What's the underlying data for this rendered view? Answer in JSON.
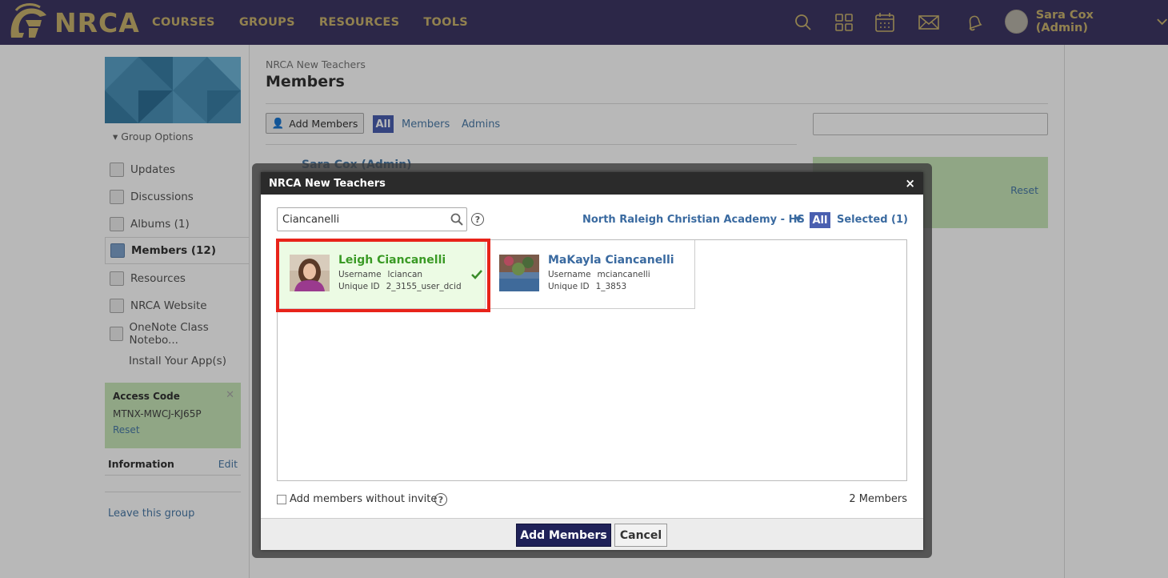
{
  "nav": {
    "brand": "NRCA",
    "links": [
      "COURSES",
      "GROUPS",
      "RESOURCES",
      "TOOLS"
    ],
    "icons": [
      "search-icon",
      "grid-icon",
      "calendar-icon",
      "mail-icon",
      "bell-icon"
    ],
    "user": "Sara Cox (Admin)"
  },
  "sidebar": {
    "group_options": "Group Options",
    "items": [
      {
        "label": "Updates",
        "icon": "updates-icon"
      },
      {
        "label": "Discussions",
        "icon": "discussions-icon"
      },
      {
        "label": "Albums (1)",
        "icon": "albums-icon"
      },
      {
        "label": "Members (12)",
        "icon": "members-icon"
      },
      {
        "label": "Resources",
        "icon": "resources-icon"
      },
      {
        "label": "NRCA Website",
        "icon": "website-icon"
      },
      {
        "label": "OneNote Class Notebo...",
        "icon": "onenote-icon"
      },
      {
        "label": "Install Your App(s)",
        "icon": ""
      }
    ],
    "access_code": {
      "title": "Access Code",
      "code": "MTNX-MWCJ-KJ65P",
      "reset": "Reset"
    },
    "information": {
      "title": "Information",
      "edit": "Edit"
    },
    "leave": "Leave this group"
  },
  "main": {
    "breadcrumb": "NRCA New Teachers",
    "title": "Members",
    "add_members_button": "Add Members",
    "filters": {
      "all": "All",
      "members": "Members",
      "admins": "Admins"
    },
    "first_member": "Sara Cox (Admin)",
    "right_panel_reset": "Reset"
  },
  "modal": {
    "title": "NRCA New Teachers",
    "close": "×",
    "search_value": "Ciancanelli",
    "help": "?",
    "school": "North Raleigh Christian Academy - HS",
    "tab_all": "All",
    "tab_selected": "Selected (1)",
    "results": [
      {
        "name": "Leigh Ciancanelli",
        "username_label": "Username",
        "username": "lciancan",
        "uid_label": "Unique ID",
        "uid": "2_3155_user_dcid",
        "selected": true
      },
      {
        "name": "MaKayla Ciancanelli",
        "username_label": "Username",
        "username": "mciancanelli",
        "uid_label": "Unique ID",
        "uid": "1_3853",
        "selected": false
      }
    ],
    "add_without_invite": "Add members without invite",
    "count": "2 Members",
    "add_button": "Add Members",
    "cancel_button": "Cancel"
  }
}
